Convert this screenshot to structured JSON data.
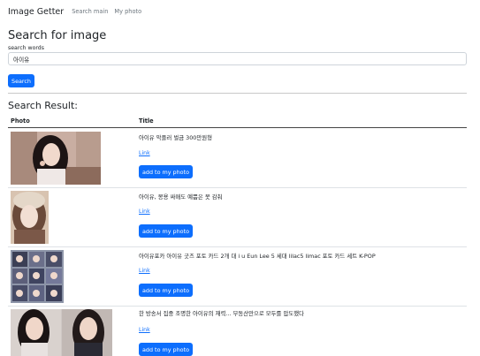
{
  "nav": {
    "brand": "Image Getter",
    "links": [
      "Search main",
      "My photo"
    ]
  },
  "search": {
    "heading": "Search for image",
    "label": "search words",
    "value": "아이유",
    "button": "Search"
  },
  "results": {
    "heading": "Search Result:",
    "columns": [
      "Photo",
      "Title"
    ],
    "link_label": "Link",
    "add_label": "add to my photo",
    "rows": [
      {
        "title": "아이유 악플러 벌금 300만원형"
      },
      {
        "title": "아이유, 몽용 싸매도 예쁨은 못 감춰"
      },
      {
        "title": "아이유포카 아이유 굿즈 포토 카드 2개 대 i u Eun Lee 5 세대 lilac5 limac 포토 카드 세트 K-POP"
      },
      {
        "title": "한 방송서 집중 조명한 아이유의 재력... 부동산만으로 모두를 압도했다"
      }
    ]
  },
  "colors": {
    "primary": "#0d6efd",
    "text": "#212529",
    "muted": "#6c757d",
    "border": "#dee2e6"
  }
}
